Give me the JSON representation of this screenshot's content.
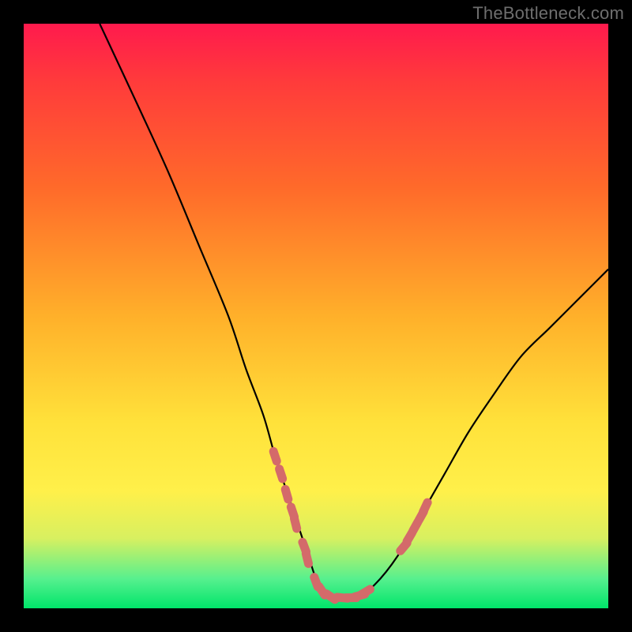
{
  "attribution": "TheBottleneck.com",
  "colors": {
    "frame": "#000000",
    "curve": "#000000",
    "dot": "#d46a6a",
    "band_outer": "#ffff9a",
    "band_mid": "#c8f070",
    "band_inner": "#00e56a"
  },
  "chart_data": {
    "type": "line",
    "title": "",
    "xlabel": "",
    "ylabel": "",
    "xlim": [
      0,
      100
    ],
    "ylim": [
      0,
      100
    ],
    "x": [
      13,
      20,
      25,
      30,
      35,
      38,
      41,
      43,
      45,
      47,
      49,
      50,
      51,
      52,
      54,
      57,
      60,
      64,
      68,
      72,
      76,
      80,
      85,
      90,
      95,
      100
    ],
    "values": [
      100,
      85,
      74,
      62,
      50,
      41,
      33,
      26,
      20,
      14,
      8,
      5,
      3,
      2,
      2,
      2,
      4,
      9,
      16,
      23,
      30,
      36,
      43,
      48,
      53,
      58
    ],
    "series": [
      {
        "name": "bottleneck-curve",
        "note": "percent bottleneck vs component score; y is percent from bottom (0 = no bottleneck)"
      }
    ],
    "dots_x": [
      43,
      44,
      45,
      46,
      46.5,
      48,
      48.5,
      50,
      51,
      52.5,
      54.5,
      56,
      57.5,
      58.5,
      65,
      66,
      67,
      68,
      68.7
    ],
    "dots_y": [
      26,
      23,
      19.5,
      16.5,
      14.5,
      10.5,
      8.5,
      4.5,
      3,
      2,
      1.8,
      1.8,
      2.2,
      2.8,
      10.5,
      12.2,
      14,
      15.8,
      17.3
    ],
    "sweet_zone_from_bottom_pct": [
      0,
      3.5,
      6.5,
      10
    ]
  }
}
